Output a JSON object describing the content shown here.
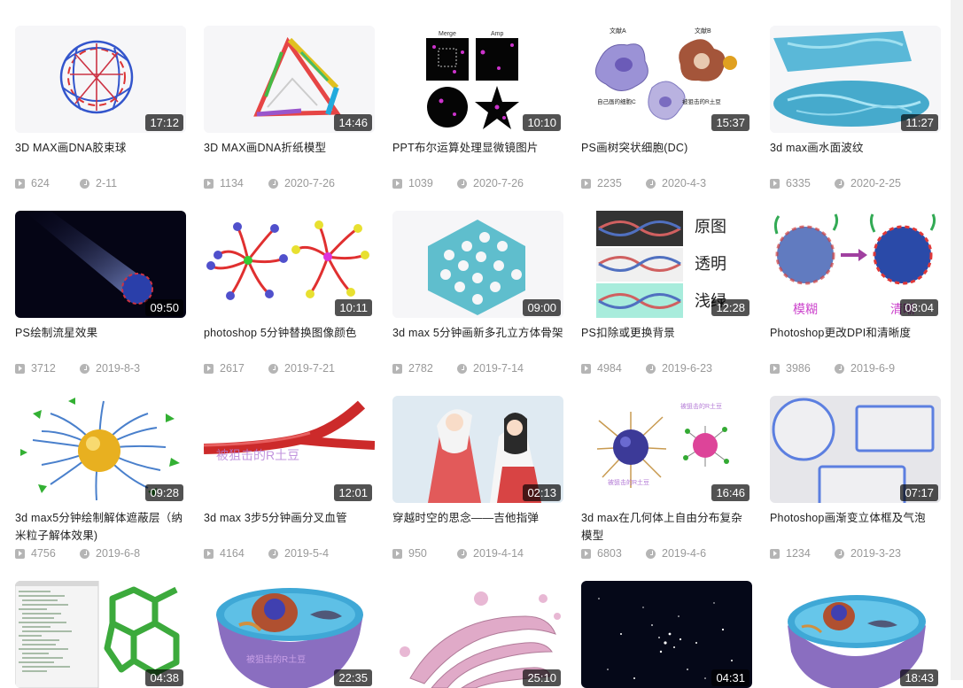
{
  "rows": [
    [
      {
        "title": "3D MAX画DNA胶束球",
        "duration": "17:12",
        "views": "624",
        "date": "2-11",
        "art": "dna-ball"
      },
      {
        "title": "3D MAX画DNA折纸模型",
        "duration": "14:46",
        "views": "1134",
        "date": "2020-7-26",
        "art": "dna-origami"
      },
      {
        "title": "PPT布尔运算处理显微镜图片",
        "duration": "10:10",
        "views": "1039",
        "date": "2020-7-26",
        "art": "microscope",
        "labels": [
          "Merge",
          "Amp"
        ]
      },
      {
        "title": "PS画树突状细胞(DC)",
        "duration": "15:37",
        "views": "2235",
        "date": "2020-4-3",
        "art": "dc-cell",
        "labels": [
          "文献A",
          "文献B",
          "自己画的细胞C",
          "被狙击的R土豆"
        ]
      },
      {
        "title": "3d max画水面波纹",
        "duration": "11:27",
        "views": "6335",
        "date": "2020-2-25",
        "art": "water"
      }
    ],
    [
      {
        "title": "PS绘制流星效果",
        "duration": "09:50",
        "views": "3712",
        "date": "2019-8-3",
        "art": "meteor"
      },
      {
        "title": "photoshop 5分钟替换图像颜色",
        "duration": "10:11",
        "views": "2617",
        "date": "2019-7-21",
        "art": "molecules"
      },
      {
        "title": "3d max 5分钟画新多孔立方体骨架",
        "duration": "09:00",
        "views": "2782",
        "date": "2019-7-14",
        "art": "porous"
      },
      {
        "title": "PS扣除或更换背景",
        "duration": "12:28",
        "views": "4984",
        "date": "2019-6-23",
        "art": "bg-replace",
        "labels": [
          "原图",
          "透明",
          "浅绿"
        ]
      },
      {
        "title": "Photoshop更改DPI和清晰度",
        "duration": "08:04",
        "views": "3986",
        "date": "2019-6-9",
        "art": "dpi",
        "labels": [
          "模糊",
          "清晰"
        ]
      }
    ],
    [
      {
        "title": "3d max5分钟绘制解体遮蔽层（纳米粒子解体效果)",
        "duration": "09:28",
        "views": "4756",
        "date": "2019-6-8",
        "art": "nanoparticle"
      },
      {
        "title": "3d max 3步5分钟画分叉血管",
        "duration": "12:01",
        "views": "4164",
        "date": "2019-5-4",
        "art": "vessel",
        "labels": [
          "被狙击的R土豆"
        ]
      },
      {
        "title": "穿越时空的思念——吉他指弹",
        "duration": "02:13",
        "views": "950",
        "date": "2019-4-14",
        "art": "anime"
      },
      {
        "title": "3d max在几何体上自由分布复杂模型",
        "duration": "16:46",
        "views": "6803",
        "date": "2019-4-6",
        "art": "geometry",
        "labels": [
          "被狙击的R土豆",
          "被狙击的R土豆"
        ]
      },
      {
        "title": "Photoshop画渐变立体框及气泡",
        "duration": "07:17",
        "views": "1234",
        "date": "2019-3-23",
        "art": "frames"
      }
    ],
    [
      {
        "title": "",
        "duration": "04:38",
        "views": "",
        "date": "",
        "art": "code"
      },
      {
        "title": "",
        "duration": "22:35",
        "views": "",
        "date": "",
        "art": "cell-half",
        "labels": [
          "被狙击的R土豆"
        ]
      },
      {
        "title": "",
        "duration": "25:10",
        "views": "",
        "date": "",
        "art": "golgi"
      },
      {
        "title": "",
        "duration": "04:31",
        "views": "",
        "date": "",
        "art": "stars"
      },
      {
        "title": "",
        "duration": "18:43",
        "views": "",
        "date": "",
        "art": "cell-full"
      }
    ]
  ],
  "colors": {
    "title": "#222222",
    "meta": "#999999",
    "icon": "#b5b5b5",
    "duration_bg": "rgba(0,0,0,0.68)"
  }
}
